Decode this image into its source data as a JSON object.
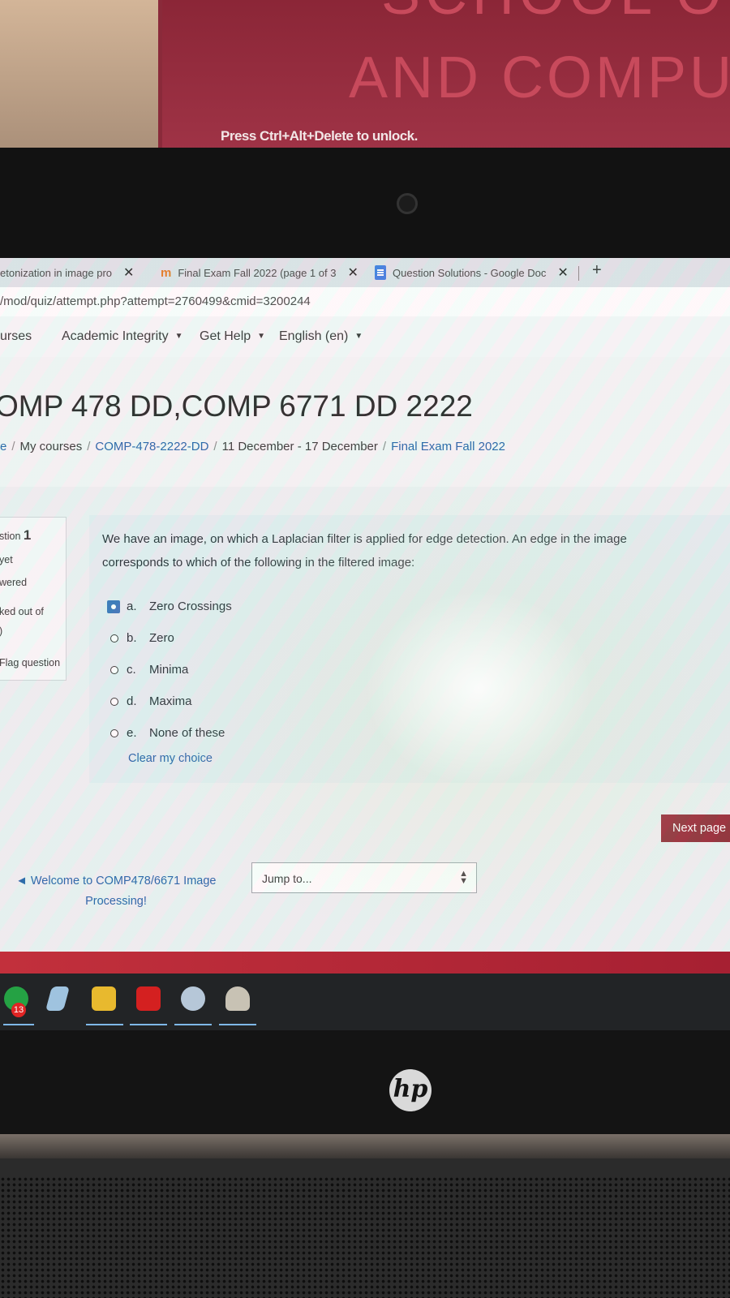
{
  "monitor": {
    "title_top": "SCHOOL OF",
    "title": "AND COMPU",
    "unlock_text": "Press Ctrl+Alt+Delete to unlock."
  },
  "browser": {
    "tabs": [
      {
        "label": "etonization in image pro",
        "icon": "page-icon"
      },
      {
        "label": "Final Exam Fall 2022 (page 1 of 3",
        "icon": "moodle-icon"
      },
      {
        "label": "Question Solutions - Google Doc",
        "icon": "google-docs-icon"
      }
    ],
    "new_tab": "+",
    "url": "/mod/quiz/attempt.php?attempt=2760499&cmid=3200244"
  },
  "navbar": {
    "items": [
      "urses",
      "Academic Integrity",
      "Get Help",
      "English (en)"
    ]
  },
  "header": {
    "course_title": "OMP 478 DD,COMP 6771 DD 2222",
    "breadcrumb": [
      "e",
      "My courses",
      "COMP-478-2222-DD",
      "11 December - 17 December",
      "Final Exam Fall 2022"
    ]
  },
  "question_info": {
    "number_label": "stion",
    "number": "1",
    "status_line1": "yet",
    "status_line2": "wered",
    "marks_line1": "ked out of",
    "marks_line2": ")",
    "flag": "Flag question"
  },
  "question": {
    "text": "We have an image, on which a Laplacian filter is applied for edge detection. An edge in the image corresponds to which of the following in the filtered image:",
    "options": [
      {
        "letter": "a.",
        "text": "Zero Crossings",
        "selected": true
      },
      {
        "letter": "b.",
        "text": "Zero",
        "selected": false
      },
      {
        "letter": "c.",
        "text": "Minima",
        "selected": false
      },
      {
        "letter": "d.",
        "text": "Maxima",
        "selected": false
      },
      {
        "letter": "e.",
        "text": "None of these",
        "selected": false
      }
    ],
    "clear_choice": "Clear my choice"
  },
  "navigation": {
    "next_page": "Next page",
    "prev_link": "◄ Welcome to COMP478/6671 Image Processing!",
    "jump_placeholder": "Jump to..."
  },
  "taskbar": {
    "badge_count": "13",
    "icons": [
      "whatsapp-icon",
      "notes-icon",
      "file-explorer-icon",
      "acrobat-icon",
      "snipping-tool-icon",
      "app-icon"
    ]
  },
  "laptop": {
    "brand": "hp"
  }
}
